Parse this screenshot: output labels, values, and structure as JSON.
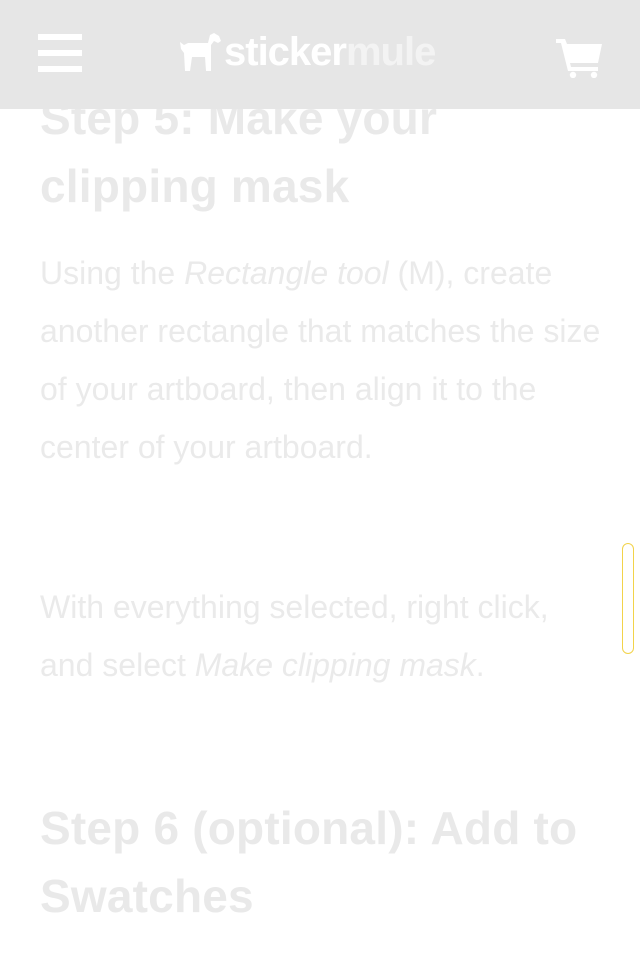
{
  "header": {
    "logo": {
      "word_part1": "sticker",
      "word_part2": "mule"
    },
    "menu_icon": "hamburger-icon",
    "cart_icon": "cart-icon",
    "background_color": "#e6e6e6"
  },
  "article": {
    "step5": {
      "heading": "Step 5: Make your clipping mask",
      "paragraph1": {
        "text_before": "Using the ",
        "italic": "Rectangle tool",
        "text_after": " (M), create another rectangle that matches the size of your artboard, then align it to the center of your artboard."
      },
      "paragraph2": {
        "text_before": "With everything selected, right click, and select ",
        "italic": "Make clipping mask",
        "text_after": "."
      }
    },
    "step6": {
      "heading": "Step 6 (optional): Add to Swatches"
    }
  },
  "scrollbar": {
    "accent_color": "#f2d34a"
  }
}
